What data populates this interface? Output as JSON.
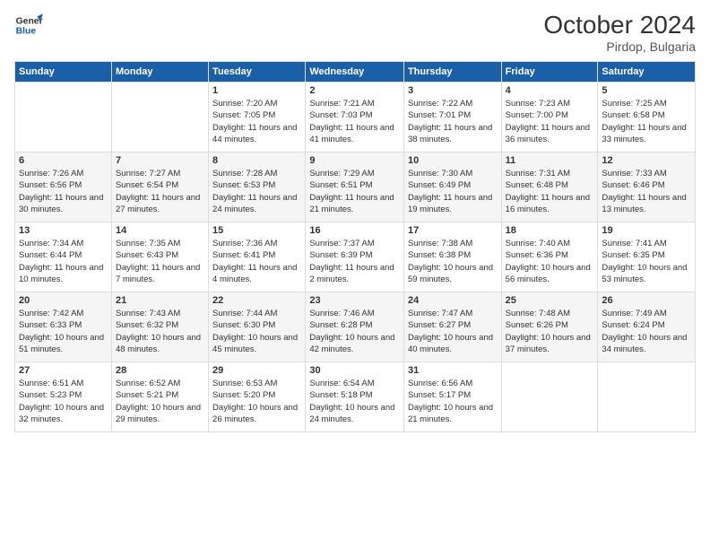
{
  "header": {
    "logo_general": "General",
    "logo_blue": "Blue",
    "month": "October 2024",
    "location": "Pirdop, Bulgaria"
  },
  "days_of_week": [
    "Sunday",
    "Monday",
    "Tuesday",
    "Wednesday",
    "Thursday",
    "Friday",
    "Saturday"
  ],
  "weeks": [
    [
      {
        "day": "",
        "detail": ""
      },
      {
        "day": "",
        "detail": ""
      },
      {
        "day": "1",
        "detail": "Sunrise: 7:20 AM\nSunset: 7:05 PM\nDaylight: 11 hours and 44 minutes."
      },
      {
        "day": "2",
        "detail": "Sunrise: 7:21 AM\nSunset: 7:03 PM\nDaylight: 11 hours and 41 minutes."
      },
      {
        "day": "3",
        "detail": "Sunrise: 7:22 AM\nSunset: 7:01 PM\nDaylight: 11 hours and 38 minutes."
      },
      {
        "day": "4",
        "detail": "Sunrise: 7:23 AM\nSunset: 7:00 PM\nDaylight: 11 hours and 36 minutes."
      },
      {
        "day": "5",
        "detail": "Sunrise: 7:25 AM\nSunset: 6:58 PM\nDaylight: 11 hours and 33 minutes."
      }
    ],
    [
      {
        "day": "6",
        "detail": "Sunrise: 7:26 AM\nSunset: 6:56 PM\nDaylight: 11 hours and 30 minutes."
      },
      {
        "day": "7",
        "detail": "Sunrise: 7:27 AM\nSunset: 6:54 PM\nDaylight: 11 hours and 27 minutes."
      },
      {
        "day": "8",
        "detail": "Sunrise: 7:28 AM\nSunset: 6:53 PM\nDaylight: 11 hours and 24 minutes."
      },
      {
        "day": "9",
        "detail": "Sunrise: 7:29 AM\nSunset: 6:51 PM\nDaylight: 11 hours and 21 minutes."
      },
      {
        "day": "10",
        "detail": "Sunrise: 7:30 AM\nSunset: 6:49 PM\nDaylight: 11 hours and 19 minutes."
      },
      {
        "day": "11",
        "detail": "Sunrise: 7:31 AM\nSunset: 6:48 PM\nDaylight: 11 hours and 16 minutes."
      },
      {
        "day": "12",
        "detail": "Sunrise: 7:33 AM\nSunset: 6:46 PM\nDaylight: 11 hours and 13 minutes."
      }
    ],
    [
      {
        "day": "13",
        "detail": "Sunrise: 7:34 AM\nSunset: 6:44 PM\nDaylight: 11 hours and 10 minutes."
      },
      {
        "day": "14",
        "detail": "Sunrise: 7:35 AM\nSunset: 6:43 PM\nDaylight: 11 hours and 7 minutes."
      },
      {
        "day": "15",
        "detail": "Sunrise: 7:36 AM\nSunset: 6:41 PM\nDaylight: 11 hours and 4 minutes."
      },
      {
        "day": "16",
        "detail": "Sunrise: 7:37 AM\nSunset: 6:39 PM\nDaylight: 11 hours and 2 minutes."
      },
      {
        "day": "17",
        "detail": "Sunrise: 7:38 AM\nSunset: 6:38 PM\nDaylight: 10 hours and 59 minutes."
      },
      {
        "day": "18",
        "detail": "Sunrise: 7:40 AM\nSunset: 6:36 PM\nDaylight: 10 hours and 56 minutes."
      },
      {
        "day": "19",
        "detail": "Sunrise: 7:41 AM\nSunset: 6:35 PM\nDaylight: 10 hours and 53 minutes."
      }
    ],
    [
      {
        "day": "20",
        "detail": "Sunrise: 7:42 AM\nSunset: 6:33 PM\nDaylight: 10 hours and 51 minutes."
      },
      {
        "day": "21",
        "detail": "Sunrise: 7:43 AM\nSunset: 6:32 PM\nDaylight: 10 hours and 48 minutes."
      },
      {
        "day": "22",
        "detail": "Sunrise: 7:44 AM\nSunset: 6:30 PM\nDaylight: 10 hours and 45 minutes."
      },
      {
        "day": "23",
        "detail": "Sunrise: 7:46 AM\nSunset: 6:28 PM\nDaylight: 10 hours and 42 minutes."
      },
      {
        "day": "24",
        "detail": "Sunrise: 7:47 AM\nSunset: 6:27 PM\nDaylight: 10 hours and 40 minutes."
      },
      {
        "day": "25",
        "detail": "Sunrise: 7:48 AM\nSunset: 6:26 PM\nDaylight: 10 hours and 37 minutes."
      },
      {
        "day": "26",
        "detail": "Sunrise: 7:49 AM\nSunset: 6:24 PM\nDaylight: 10 hours and 34 minutes."
      }
    ],
    [
      {
        "day": "27",
        "detail": "Sunrise: 6:51 AM\nSunset: 5:23 PM\nDaylight: 10 hours and 32 minutes."
      },
      {
        "day": "28",
        "detail": "Sunrise: 6:52 AM\nSunset: 5:21 PM\nDaylight: 10 hours and 29 minutes."
      },
      {
        "day": "29",
        "detail": "Sunrise: 6:53 AM\nSunset: 5:20 PM\nDaylight: 10 hours and 26 minutes."
      },
      {
        "day": "30",
        "detail": "Sunrise: 6:54 AM\nSunset: 5:18 PM\nDaylight: 10 hours and 24 minutes."
      },
      {
        "day": "31",
        "detail": "Sunrise: 6:56 AM\nSunset: 5:17 PM\nDaylight: 10 hours and 21 minutes."
      },
      {
        "day": "",
        "detail": ""
      },
      {
        "day": "",
        "detail": ""
      }
    ]
  ]
}
